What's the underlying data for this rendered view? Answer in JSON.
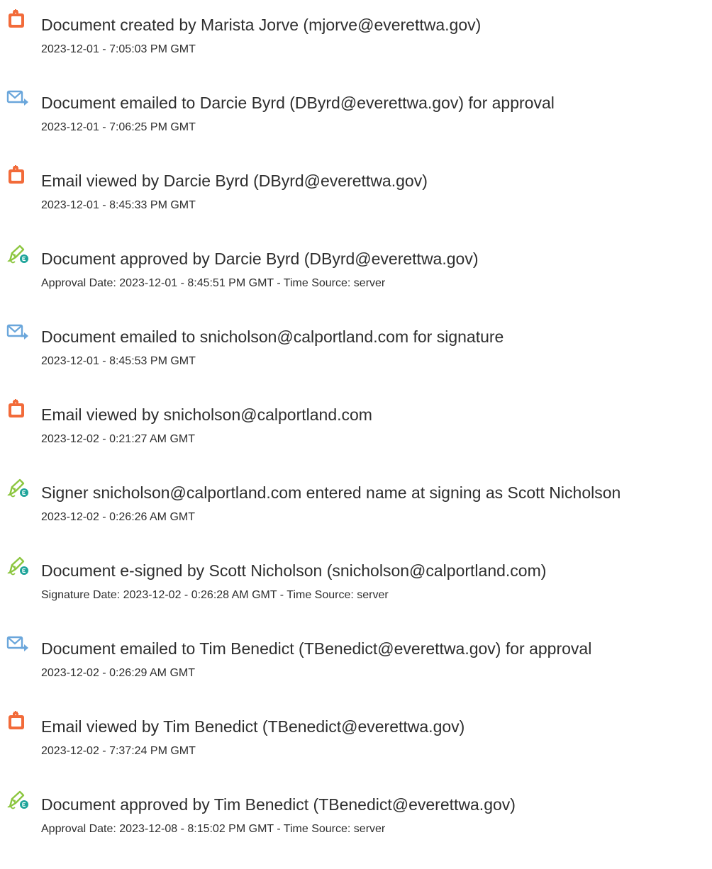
{
  "events": [
    {
      "icon": "document-created-icon",
      "title": "Document created by Marista Jorve (mjorve@everettwa.gov)",
      "date": "2023-12-01 - 7:05:03 PM GMT"
    },
    {
      "icon": "email-sent-icon",
      "title": "Document emailed to Darcie Byrd (DByrd@everettwa.gov) for approval",
      "date": "2023-12-01 - 7:06:25 PM GMT"
    },
    {
      "icon": "document-viewed-icon",
      "title": "Email viewed by Darcie Byrd (DByrd@everettwa.gov)",
      "date": "2023-12-01 - 8:45:33 PM GMT"
    },
    {
      "icon": "pen-signed-icon",
      "title": "Document approved by Darcie Byrd (DByrd@everettwa.gov)",
      "date": "Approval Date: 2023-12-01 - 8:45:51 PM GMT - Time Source: server"
    },
    {
      "icon": "email-sent-icon",
      "title": "Document emailed to snicholson@calportland.com for signature",
      "date": "2023-12-01 - 8:45:53 PM GMT"
    },
    {
      "icon": "document-viewed-icon",
      "title": "Email viewed by snicholson@calportland.com",
      "date": "2023-12-02 - 0:21:27 AM GMT"
    },
    {
      "icon": "pen-signed-icon",
      "title": "Signer snicholson@calportland.com entered name at signing as Scott Nicholson",
      "date": "2023-12-02 - 0:26:26 AM GMT"
    },
    {
      "icon": "pen-signed-icon",
      "title": "Document e-signed by Scott Nicholson (snicholson@calportland.com)",
      "date": "Signature Date: 2023-12-02 - 0:26:28 AM GMT - Time Source: server"
    },
    {
      "icon": "email-sent-icon",
      "title": "Document emailed to Tim Benedict (TBenedict@everettwa.gov) for approval",
      "date": "2023-12-02 - 0:26:29 AM GMT"
    },
    {
      "icon": "document-viewed-icon",
      "title": "Email viewed by Tim Benedict (TBenedict@everettwa.gov)",
      "date": "2023-12-02 - 7:37:24 PM GMT"
    },
    {
      "icon": "pen-signed-icon",
      "title": "Document approved by Tim Benedict (TBenedict@everettwa.gov)",
      "date": "Approval Date: 2023-12-08 - 8:15:02 PM GMT - Time Source: server"
    }
  ],
  "colors": {
    "doc_icon": "#f26b3a",
    "email_icon": "#6aa6db",
    "pen_icon": "#8cc63f",
    "pen_badge": "#1ea49a"
  }
}
